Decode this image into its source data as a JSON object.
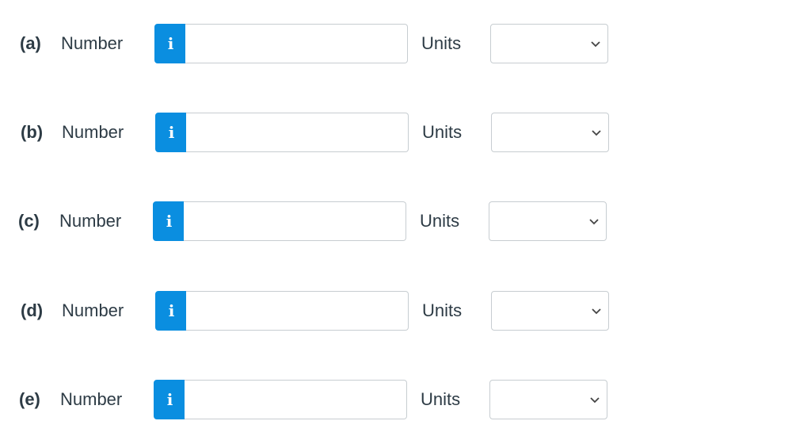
{
  "rows": [
    {
      "part": "(a)",
      "number_label": "Number",
      "info_icon": "i",
      "number_value": "",
      "units_label": "Units",
      "units_selected": ""
    },
    {
      "part": "(b)",
      "number_label": "Number",
      "info_icon": "i",
      "number_value": "",
      "units_label": "Units",
      "units_selected": ""
    },
    {
      "part": "(c)",
      "number_label": "Number",
      "info_icon": "i",
      "number_value": "",
      "units_label": "Units",
      "units_selected": ""
    },
    {
      "part": "(d)",
      "number_label": "Number",
      "info_icon": "i",
      "number_value": "",
      "units_label": "Units",
      "units_selected": ""
    },
    {
      "part": "(e)",
      "number_label": "Number",
      "info_icon": "i",
      "number_value": "",
      "units_label": "Units",
      "units_selected": ""
    }
  ],
  "colors": {
    "info_button": "#0a8ee0",
    "text": "#2d3b45",
    "border": "#c7cdd1"
  }
}
